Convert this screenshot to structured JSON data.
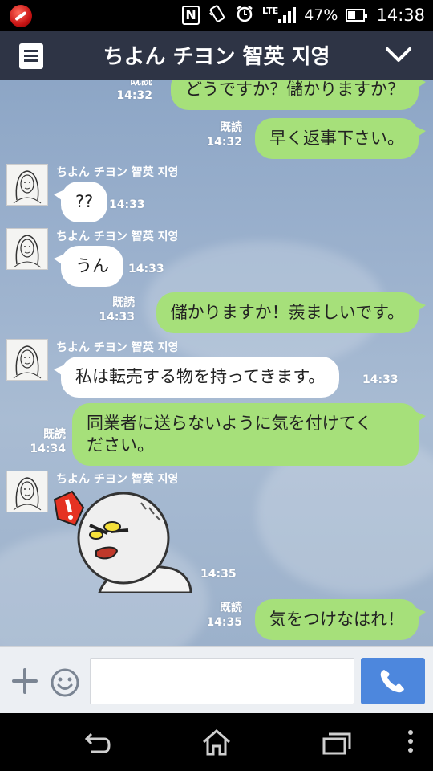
{
  "status_bar": {
    "lte_label": "LTE",
    "battery_percent": "47%",
    "time": "14:38",
    "icons": [
      "app-icon",
      "nfc-icon",
      "vibrate-icon",
      "alarm-icon",
      "signal-icon",
      "battery-icon"
    ]
  },
  "header": {
    "title": "ちよん チヨン 智英 지영",
    "menu_icon": "menu-icon",
    "dropdown_icon": "chevron-down-icon"
  },
  "messages": [
    {
      "side": "me",
      "text": "どうですか？儲かりますか？",
      "read": "既読",
      "time": "14:32"
    },
    {
      "side": "me",
      "text": "早く返事下さい。",
      "read": "既読",
      "time": "14:32"
    },
    {
      "side": "them",
      "sender": "ちよん チヨン 智英 지영",
      "text": "??",
      "time": "14:33"
    },
    {
      "side": "them",
      "sender": "ちよん チヨン 智英 지영",
      "text": "うん",
      "time": "14:33"
    },
    {
      "side": "me",
      "text": "儲かりますか！羨ましいです。",
      "read": "既読",
      "time": "14:33"
    },
    {
      "side": "them",
      "sender": "ちよん チヨン 智英 지영",
      "text": "私は転売する物を持ってきます。",
      "time": "14:33"
    },
    {
      "side": "me",
      "text_line1": "同業者に送らないように気を付けてく",
      "text_line2": "ださい。",
      "read": "既読",
      "time": "14:34"
    },
    {
      "side": "them",
      "sender": "ちよん チヨン 智英 지영",
      "sticker": "angry-moon-sticker",
      "time": "14:35"
    },
    {
      "side": "me",
      "text": "気をつけなはれ！",
      "read": "既読",
      "time": "14:35"
    }
  ],
  "input_bar": {
    "placeholder": "",
    "add_icon": "plus-icon",
    "emoji_icon": "smile-icon",
    "call_icon": "phone-icon"
  },
  "nav_bar": {
    "icons": [
      "back-icon",
      "home-icon",
      "recent-apps-icon",
      "overflow-menu-icon"
    ]
  },
  "colors": {
    "header_bg": "#2e3445",
    "my_bubble": "#a6e07a",
    "their_bubble": "#ffffff",
    "call_button": "#4d87dd"
  }
}
